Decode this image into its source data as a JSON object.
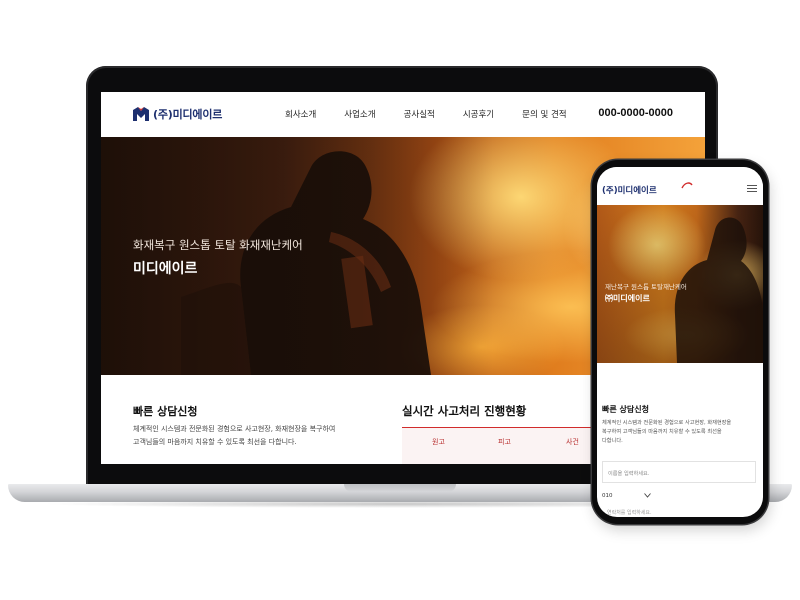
{
  "desktop": {
    "logo_text": "(주)미디에이르",
    "nav": [
      "회사소개",
      "사업소개",
      "공사실적",
      "시공후기",
      "문의 및 견적"
    ],
    "phone": "000-0000-0000",
    "hero": {
      "subtitle": "화재복구 원스톱 토탈 화재재난케어",
      "title": "미디에이르"
    },
    "consult": {
      "title": "빠른 상담신청",
      "desc_line1": "체계적인 시스템과 전문화된 경험으로 사고현장, 화재현장을 복구하여",
      "desc_line2": "고객님들의 마음까지 치유할 수 있도록 최선을 다합니다."
    },
    "status": {
      "title": "실시간 사고처리 진행현황",
      "columns": [
        "원고",
        "피고",
        "사건"
      ]
    }
  },
  "mobile": {
    "logo_text": "(주)미디에이르",
    "hero": {
      "subtitle": "재난복구 원스톱 토탈재난케어",
      "title": "㈜미디에이르"
    },
    "consult": {
      "title": "빠른 상담신청",
      "desc_line1": "체계적인 시스템과 전문화된 경험으로 사고현장, 화재현장을",
      "desc_line2": "복구하여 고객님들의 마음까지 치유할 수 있도록 최선을",
      "desc_line3": "다합니다."
    },
    "name_placeholder": "이름을 입력하세요.",
    "phone_prefix": "010",
    "second_placeholder": "연락처를 입력하세요."
  },
  "colors": {
    "brand_navy": "#1d2f6f",
    "brand_red": "#d12c2c",
    "status_text": "#b83030"
  },
  "icons": [
    "logo-mark-icon",
    "hamburger-menu-icon",
    "chevron-down-icon"
  ]
}
